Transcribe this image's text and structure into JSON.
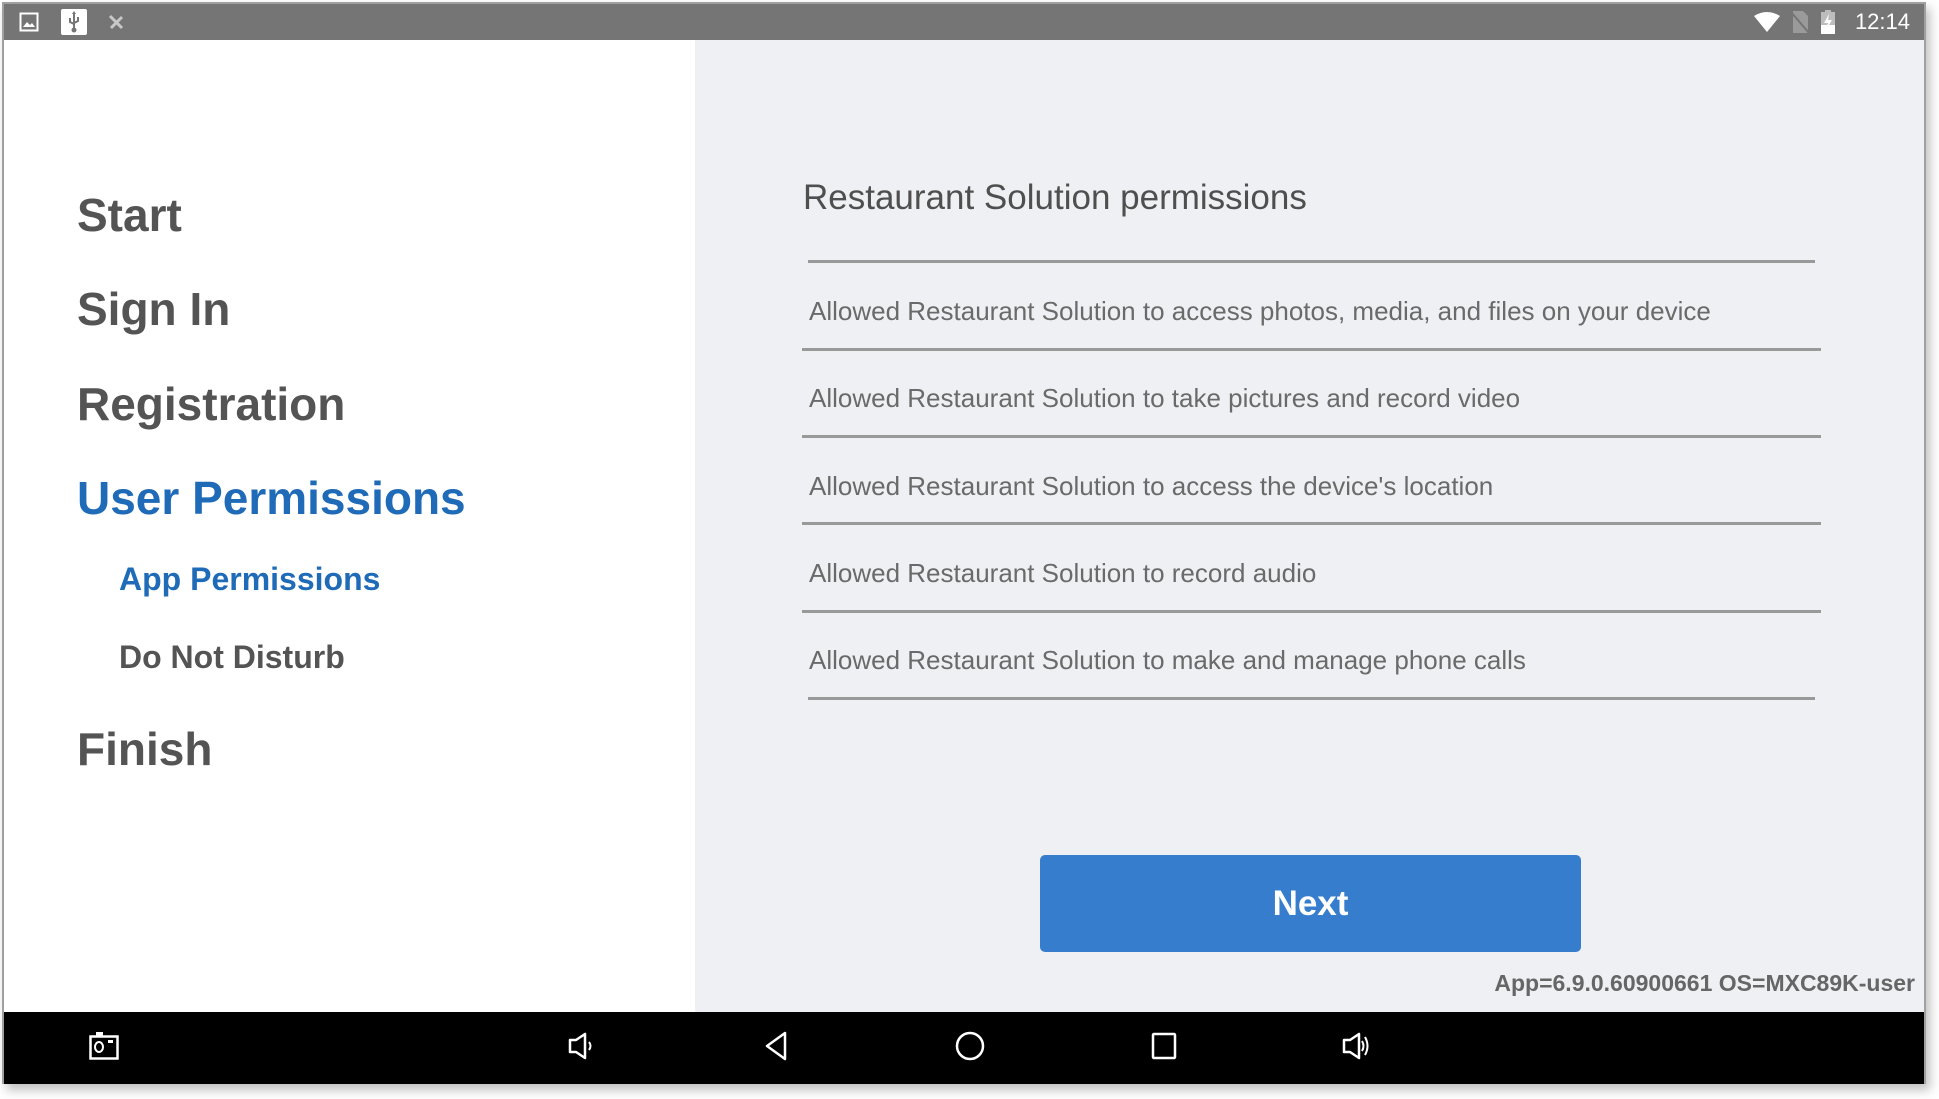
{
  "status_bar": {
    "left_icons": [
      "image-icon",
      "usb-icon",
      "no-sync-icon"
    ],
    "right_icons": [
      "wifi-icon",
      "no-sim-icon",
      "battery-charging-icon"
    ],
    "time": "12:14"
  },
  "sidebar": {
    "items": [
      {
        "label": "Start",
        "active": false
      },
      {
        "label": "Sign In",
        "active": false
      },
      {
        "label": "Registration",
        "active": false
      },
      {
        "label": "User Permissions",
        "active": true
      },
      {
        "label": "Finish",
        "active": false
      }
    ],
    "sub_items": [
      {
        "label": "App Permissions",
        "active": true
      },
      {
        "label": "Do Not Disturb",
        "active": false
      }
    ]
  },
  "main": {
    "title": "Restaurant Solution permissions",
    "permissions": [
      "Allowed Restaurant Solution to access photos, media, and files on your device",
      "Allowed Restaurant Solution to take pictures and record video",
      "Allowed Restaurant Solution to access the device's location",
      "Allowed Restaurant Solution to record audio",
      "Allowed Restaurant Solution to make and manage phone calls"
    ],
    "next_label": "Next",
    "version_text": "App=6.9.0.60900661 OS=MXC89K-user"
  },
  "nav_bar": {
    "buttons": [
      "screenshot-icon",
      "volume-down-icon",
      "back-icon",
      "home-icon",
      "recents-icon",
      "volume-up-icon"
    ]
  },
  "colors": {
    "accent": "#1f6bb8",
    "button": "#367ecd",
    "status_bar": "#757575",
    "panel_bg": "#eff0f4"
  }
}
